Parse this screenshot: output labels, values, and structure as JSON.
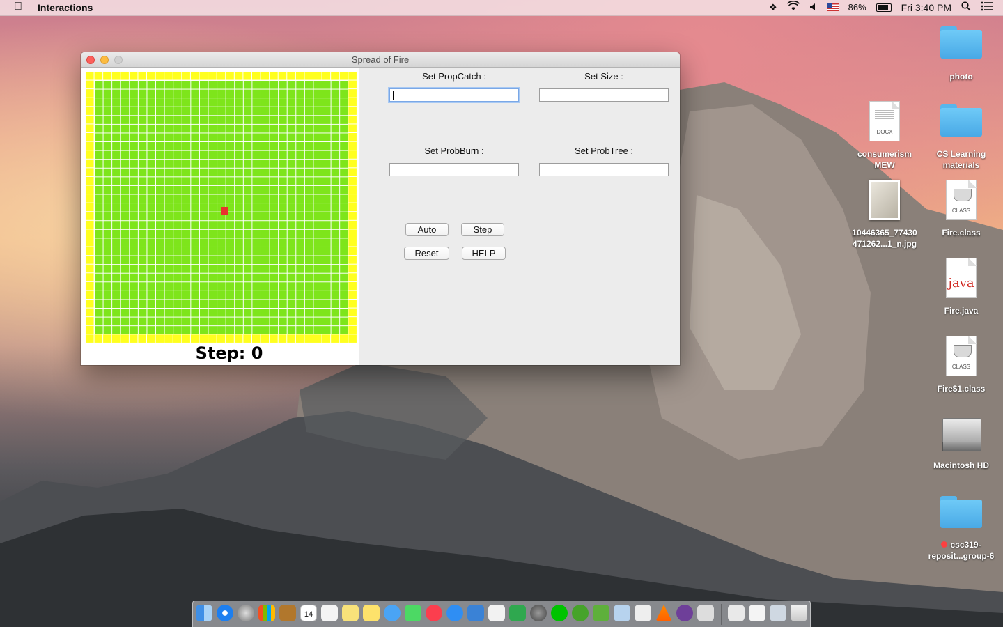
{
  "menubar": {
    "app_name": "Interactions",
    "battery": "86%",
    "clock": "Fri 3:40 PM"
  },
  "window": {
    "title": "Spread of Fire",
    "step_text": "Step: 0",
    "labels": {
      "prop_catch": "Set PropCatch :",
      "size": "Set Size :",
      "prob_burn": "Set ProbBurn :",
      "prob_tree": "Set ProbTree :"
    },
    "fields": {
      "prop_catch": "",
      "size": "",
      "prob_burn": "",
      "prob_tree": ""
    },
    "buttons": {
      "auto": "Auto",
      "step": "Step",
      "reset": "Reset",
      "help": "HELP"
    },
    "grid_colors": {
      "border_cells": "#ffff1f",
      "tree_cells": "#7ee51b",
      "burning_cell": "#e8322e"
    }
  },
  "desktop": {
    "icons": [
      {
        "label1": "photo",
        "label2": ""
      },
      {
        "label1": "consumerism",
        "label2": "MEW",
        "tag": "DOCX"
      },
      {
        "label1": "CS Learning",
        "label2": "materials"
      },
      {
        "label1": "10446365_77430",
        "label2": "471262...1_n.jpg"
      },
      {
        "label1": "Fire.class",
        "label2": "",
        "tag": "CLASS"
      },
      {
        "label1": "Fire.java",
        "label2": "",
        "tag": "java"
      },
      {
        "label1": "Fire$1.class",
        "label2": "",
        "tag": "CLASS"
      },
      {
        "label1": "Macintosh HD",
        "label2": ""
      },
      {
        "label1": "csc319-",
        "label2": "reposit...group-6"
      }
    ]
  },
  "dock": {
    "calendar_day": "14"
  }
}
